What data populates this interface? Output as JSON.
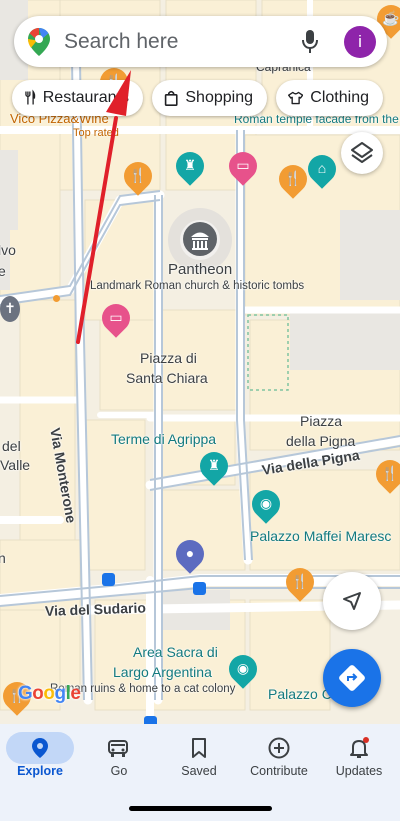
{
  "search": {
    "placeholder": "Search here",
    "avatar_letter": "i"
  },
  "chips": [
    {
      "label": "Restaurants",
      "icon": "fork-knife-icon"
    },
    {
      "label": "Shopping",
      "icon": "shopping-bag-icon"
    },
    {
      "label": "Clothing",
      "icon": "shirt-icon"
    }
  ],
  "map": {
    "labels": {
      "pantheon": "Pantheon",
      "pantheon_sub": "Landmark Roman church & historic tombs",
      "piazza_santa_chiara_1": "Piazza di",
      "piazza_santa_chiara_2": "Santa Chiara",
      "terme_agrippa": "Terme di Agrippa",
      "piazza_pigna_1": "Piazza",
      "piazza_pigna_2": "della Pigna",
      "via_pigna": "Via della Pigna",
      "palazzo_maffei": "Palazzo Maffei Maresc",
      "via_sudario": "Via del Sudario",
      "area_sacra_1": "Area Sacra di",
      "area_sacra_2": "Largo Argentina",
      "area_sacra_sub": "Roman ruins & home to a cat colony",
      "palazzo_co": "Palazzo Co",
      "vico_pizza": "Vico Pizza&Wine",
      "top_rated": "Top rated",
      "roman_temple": "Roman temple facade from the",
      "capranica": "Capranica",
      "via_monterone": "Via Monterone",
      "left_vo": "lvo",
      "left_e": "e",
      "left_del": "del",
      "left_valle": "Valle",
      "left_n": "n"
    },
    "google": "Google"
  },
  "nav": {
    "items": [
      {
        "label": "Explore",
        "icon": "location-pin-icon",
        "active": true
      },
      {
        "label": "Go",
        "icon": "car-icon",
        "active": false
      },
      {
        "label": "Saved",
        "icon": "bookmark-icon",
        "active": false
      },
      {
        "label": "Contribute",
        "icon": "add-circle-icon",
        "active": false
      },
      {
        "label": "Updates",
        "icon": "bell-icon",
        "active": false
      }
    ]
  },
  "colors": {
    "accent": "#1a73e8",
    "annotation": "#e0202a",
    "map_bg": "#f4efe2",
    "road": "#ffffff"
  }
}
